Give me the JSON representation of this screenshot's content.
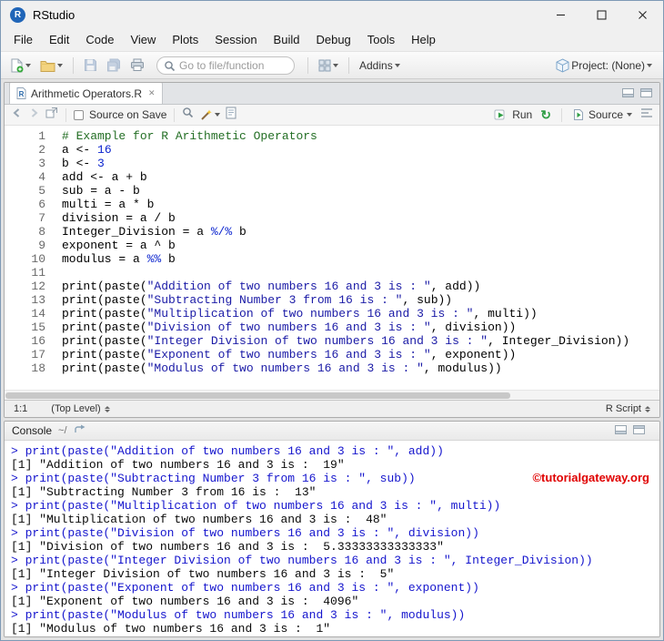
{
  "window": {
    "title": "RStudio"
  },
  "menu": [
    "File",
    "Edit",
    "Code",
    "View",
    "Plots",
    "Session",
    "Build",
    "Debug",
    "Tools",
    "Help"
  ],
  "toolbar": {
    "goto_placeholder": "Go to file/function",
    "addins_label": "Addins",
    "project_label": "Project: (None)"
  },
  "icons": {
    "logo_glyph": "R",
    "r_file_glyph": "R",
    "tab_close_glyph": "✕",
    "rerun_glyph": "↻"
  },
  "editor": {
    "tab_label": "Arithmetic Operators.R",
    "source_on_save_label": "Source on Save",
    "run_label": "Run",
    "source_label": "Source",
    "status_cursor": "1:1",
    "status_scope": "(Top Level)",
    "status_filetype": "R Script",
    "lines": [
      [
        {
          "c": "comment",
          "t": "# Example for R Arithmetic Operators"
        }
      ],
      [
        {
          "c": "plain",
          "t": "a <- "
        },
        {
          "c": "number",
          "t": "16"
        }
      ],
      [
        {
          "c": "plain",
          "t": "b <- "
        },
        {
          "c": "number",
          "t": "3"
        }
      ],
      [
        {
          "c": "plain",
          "t": "add <- a + b"
        }
      ],
      [
        {
          "c": "plain",
          "t": "sub = a - b"
        }
      ],
      [
        {
          "c": "plain",
          "t": "multi = a * b"
        }
      ],
      [
        {
          "c": "plain",
          "t": "division = a / b"
        }
      ],
      [
        {
          "c": "plain",
          "t": "Integer_Division = a "
        },
        {
          "c": "operator",
          "t": "%/%"
        },
        {
          "c": "plain",
          "t": " b"
        }
      ],
      [
        {
          "c": "plain",
          "t": "exponent = a ^ b"
        }
      ],
      [
        {
          "c": "plain",
          "t": "modulus = a "
        },
        {
          "c": "operator",
          "t": "%%"
        },
        {
          "c": "plain",
          "t": " b"
        }
      ],
      [],
      [
        {
          "c": "plain",
          "t": "print(paste("
        },
        {
          "c": "string",
          "t": "\"Addition of two numbers 16 and 3 is : \""
        },
        {
          "c": "plain",
          "t": ", add))"
        }
      ],
      [
        {
          "c": "plain",
          "t": "print(paste("
        },
        {
          "c": "string",
          "t": "\"Subtracting Number 3 from 16 is : \""
        },
        {
          "c": "plain",
          "t": ", sub))"
        }
      ],
      [
        {
          "c": "plain",
          "t": "print(paste("
        },
        {
          "c": "string",
          "t": "\"Multiplication of two numbers 16 and 3 is : \""
        },
        {
          "c": "plain",
          "t": ", multi))"
        }
      ],
      [
        {
          "c": "plain",
          "t": "print(paste("
        },
        {
          "c": "string",
          "t": "\"Division of two numbers 16 and 3 is : \""
        },
        {
          "c": "plain",
          "t": ", division))"
        }
      ],
      [
        {
          "c": "plain",
          "t": "print(paste("
        },
        {
          "c": "string",
          "t": "\"Integer Division of two numbers 16 and 3 is : \""
        },
        {
          "c": "plain",
          "t": ", Integer_Division))"
        }
      ],
      [
        {
          "c": "plain",
          "t": "print(paste("
        },
        {
          "c": "string",
          "t": "\"Exponent of two numbers 16 and 3 is : \""
        },
        {
          "c": "plain",
          "t": ", exponent))"
        }
      ],
      [
        {
          "c": "plain",
          "t": "print(paste("
        },
        {
          "c": "string",
          "t": "\"Modulus of two numbers 16 and 3 is : \""
        },
        {
          "c": "plain",
          "t": ", modulus))"
        }
      ]
    ]
  },
  "console": {
    "title": "Console",
    "path": "~/",
    "lines": [
      {
        "type": "input",
        "text": "> print(paste(\"Addition of two numbers 16 and 3 is : \", add))"
      },
      {
        "type": "output",
        "text": "[1] \"Addition of two numbers 16 and 3 is :  19\""
      },
      {
        "type": "input",
        "text": "> print(paste(\"Subtracting Number 3 from 16 is : \", sub))"
      },
      {
        "type": "output",
        "text": "[1] \"Subtracting Number 3 from 16 is :  13\""
      },
      {
        "type": "input",
        "text": "> print(paste(\"Multiplication of two numbers 16 and 3 is : \", multi))"
      },
      {
        "type": "output",
        "text": "[1] \"Multiplication of two numbers 16 and 3 is :  48\""
      },
      {
        "type": "input",
        "text": "> print(paste(\"Division of two numbers 16 and 3 is : \", division))"
      },
      {
        "type": "output",
        "text": "[1] \"Division of two numbers 16 and 3 is :  5.33333333333333\""
      },
      {
        "type": "input",
        "text": "> print(paste(\"Integer Division of two numbers 16 and 3 is : \", Integer_Division))"
      },
      {
        "type": "output",
        "text": "[1] \"Integer Division of two numbers 16 and 3 is :  5\""
      },
      {
        "type": "input",
        "text": "> print(paste(\"Exponent of two numbers 16 and 3 is : \", exponent))"
      },
      {
        "type": "output",
        "text": "[1] \"Exponent of two numbers 16 and 3 is :  4096\""
      },
      {
        "type": "input",
        "text": "> print(paste(\"Modulus of two numbers 16 and 3 is : \", modulus))"
      },
      {
        "type": "output",
        "text": "[1] \"Modulus of two numbers 16 and 3 is :  1\""
      }
    ]
  },
  "watermark": "©tutorialgateway.org",
  "colors": {
    "console_input": "#1515CD",
    "syntax_comment": "#236E24",
    "syntax_string": "#1A1AA6",
    "syntax_number": "#0B24CE",
    "watermark_red": "#E00000",
    "run_green": "#2E9E44"
  }
}
